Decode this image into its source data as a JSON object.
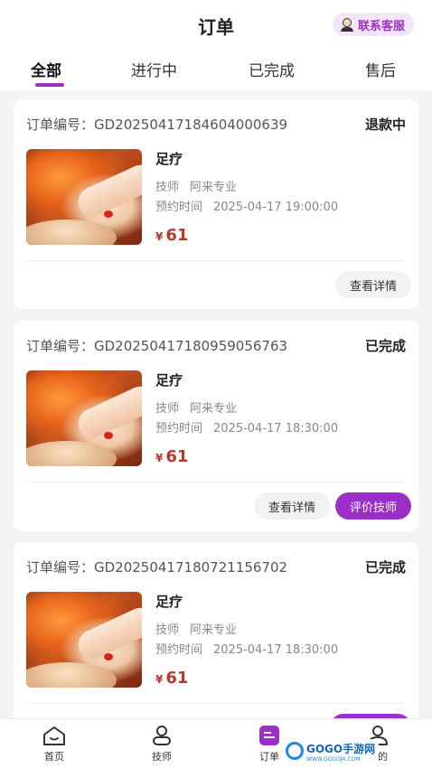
{
  "header": {
    "title": "订单",
    "contact_label": "联系客服"
  },
  "tabs": [
    {
      "label": "全部",
      "active": true
    },
    {
      "label": "进行中",
      "active": false
    },
    {
      "label": "已完成",
      "active": false
    },
    {
      "label": "售后",
      "active": false
    }
  ],
  "orders": [
    {
      "order_no": "订单编号：GD20250417184604000639",
      "status": "退款中",
      "service": "足疗",
      "tech_label": "技师",
      "tech_name": "阿来专业",
      "time_label": "预约时间",
      "time_value": "2025-04-17 19:00:00",
      "currency": "¥",
      "price": "61",
      "buttons": [
        "查看详情"
      ]
    },
    {
      "order_no": "订单编号：GD20250417180959056763",
      "status": "已完成",
      "service": "足疗",
      "tech_label": "技师",
      "tech_name": "阿来专业",
      "time_label": "预约时间",
      "time_value": "2025-04-17 18:30:00",
      "currency": "¥",
      "price": "61",
      "buttons": [
        "查看详情",
        "评价技师"
      ]
    },
    {
      "order_no": "订单编号：GD20250417180721156702",
      "status": "已完成",
      "service": "足疗",
      "tech_label": "技师",
      "tech_name": "阿来专业",
      "time_label": "预约时间",
      "time_value": "2025-04-17 18:30:00",
      "currency": "¥",
      "price": "61",
      "buttons": []
    }
  ],
  "tabbar": [
    {
      "label": "首页",
      "icon": "home-icon"
    },
    {
      "label": "技师",
      "icon": "technician-icon"
    },
    {
      "label": "订单",
      "icon": "order-icon",
      "active": true
    },
    {
      "label": "我的",
      "icon": "profile-icon"
    }
  ],
  "watermark": {
    "text": "GOGO手游网",
    "sub": "WWW.GOGOJA.COM"
  },
  "colors": {
    "accent": "#9b2fc7",
    "price": "#b73a2c",
    "background": "#f4f4f4"
  }
}
